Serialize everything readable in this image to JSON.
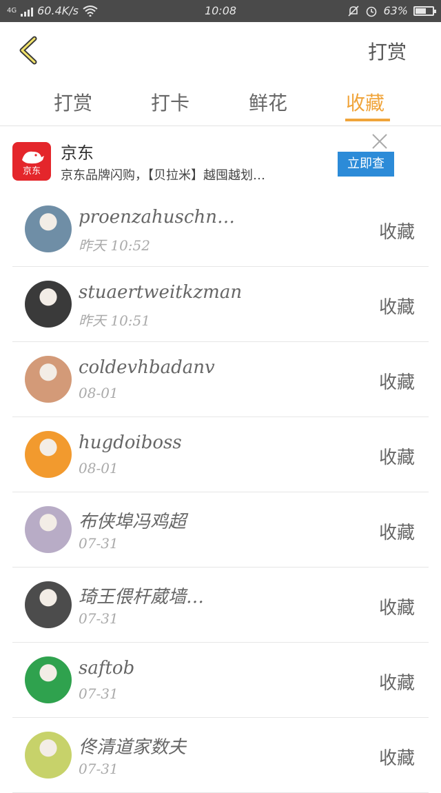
{
  "status_bar": {
    "network_type": "4G",
    "speed": "60.4K/s",
    "time": "10:08",
    "battery": "63%",
    "battery_level": 0.63
  },
  "header": {
    "action_label": "打赏"
  },
  "tabs": [
    {
      "label": "打赏",
      "active": false
    },
    {
      "label": "打卡",
      "active": false
    },
    {
      "label": "鲜花",
      "active": false
    },
    {
      "label": "收藏",
      "active": true
    }
  ],
  "ad": {
    "brand_logo_text": "京东",
    "title": "京东",
    "description": "京东品牌闪购，【贝拉米】越囤越划…",
    "button_label": "立即查"
  },
  "users": [
    {
      "name": "proenzahuschnoul…",
      "time": "昨天 10:52",
      "action": "收藏",
      "avatar_color": "#6f8ea6"
    },
    {
      "name": "stuaertweitkzman",
      "time": "昨天 10:51",
      "action": "收藏",
      "avatar_color": "#3a3a3a"
    },
    {
      "name": "coldevhbadanv",
      "time": "08-01",
      "action": "收藏",
      "avatar_color": "#d39a78"
    },
    {
      "name": "hugdoiboss",
      "time": "08-01",
      "action": "收藏",
      "avatar_color": "#f29a2e"
    },
    {
      "name": "布侠埠冯鸡超",
      "time": "07-31",
      "action": "收藏",
      "avatar_color": "#b8acc6"
    },
    {
      "name": "琦王偎杆葳墙…",
      "time": "07-31",
      "action": "收藏",
      "avatar_color": "#4c4c4c"
    },
    {
      "name": "saftob",
      "time": "07-31",
      "action": "收藏",
      "avatar_color": "#2fa24e"
    },
    {
      "name": "佟清道家数夫",
      "time": "07-31",
      "action": "收藏",
      "avatar_color": "#c7d26a"
    }
  ],
  "colors": {
    "accent": "#f0a43a",
    "ad_button": "#2c8bd8",
    "brand_red": "#e4262b",
    "status_bar": "#4a4a4a"
  }
}
